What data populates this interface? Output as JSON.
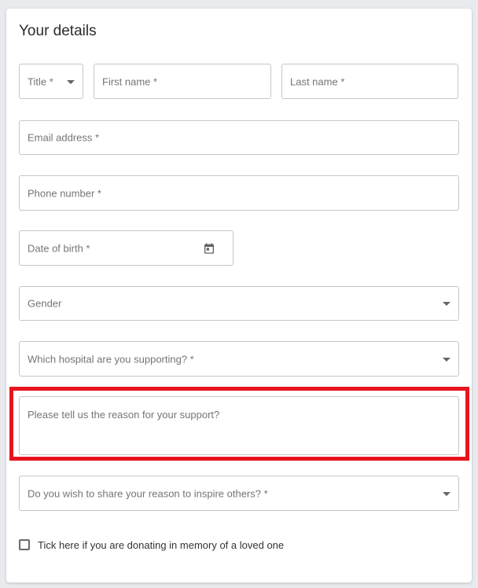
{
  "form": {
    "heading": "Your details",
    "fields": {
      "title": {
        "label": "Title *",
        "type": "select"
      },
      "first_name": {
        "label": "First name *",
        "type": "text"
      },
      "last_name": {
        "label": "Last name *",
        "type": "text"
      },
      "email": {
        "label": "Email address *",
        "type": "text"
      },
      "phone": {
        "label": "Phone number *",
        "type": "text"
      },
      "dob": {
        "label": "Date of birth *",
        "type": "date",
        "icon": "calendar-icon"
      },
      "gender": {
        "label": "Gender",
        "type": "select"
      },
      "hospital": {
        "label": "Which hospital are you supporting? *",
        "type": "select"
      },
      "reason": {
        "label": "Please tell us the reason for your support?",
        "type": "textarea"
      },
      "share_reason": {
        "label": "Do you wish to share your reason to inspire others? *",
        "type": "select"
      }
    },
    "memory_checkbox": {
      "label": "Tick here if you are donating in memory of a loved one",
      "checked": false
    }
  },
  "highlight": {
    "color": "#e8141d",
    "target": "reason"
  }
}
